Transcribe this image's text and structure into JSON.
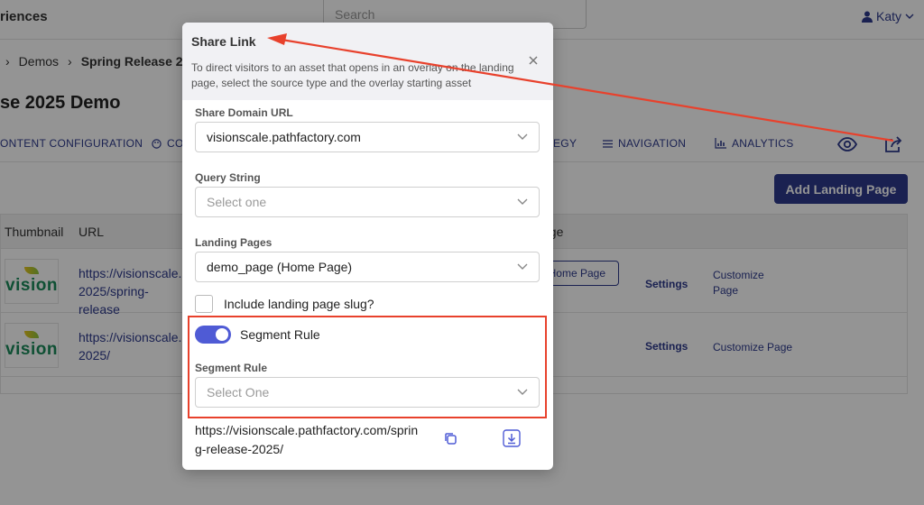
{
  "app": {
    "title": "riences",
    "search_placeholder": "Search",
    "user_name": "Katy"
  },
  "breadcrumb": {
    "items": [
      "Demos"
    ],
    "current": "Spring Release 2"
  },
  "page": {
    "title": "se 2025 Demo"
  },
  "navtabs": [
    {
      "label": "ONTENT CONFIGURATION",
      "icon": "none"
    },
    {
      "label": "CO",
      "icon": "palette-icon"
    },
    {
      "label": "EGY",
      "icon": "none"
    },
    {
      "label": "NAVIGATION",
      "icon": "list-icon"
    },
    {
      "label": "ANALYTICS",
      "icon": "bar-chart-icon"
    }
  ],
  "toolbar_icons": [
    "eye-icon",
    "share-icon"
  ],
  "add_landing_page_label": "Add Landing Page",
  "table": {
    "headers": [
      "Thumbnail",
      "URL",
      "age"
    ],
    "rows": [
      {
        "thumb_text": "vision",
        "url": "https://visionscale.p 2025/spring-release",
        "home_button": "Home Page",
        "settings": "Settings",
        "customize": "Customize Page"
      },
      {
        "thumb_text": "vision",
        "url": "https://visionscale.p 2025/",
        "home_button": "",
        "settings": "Settings",
        "customize": "Customize Page"
      }
    ]
  },
  "modal": {
    "title": "Share Link",
    "description": "To direct visitors to an asset that opens in an overlay on the landing page, select the source type and the overlay starting asset",
    "close_icon": "close-icon",
    "share_domain": {
      "label": "Share Domain URL",
      "value": "visionscale.pathfactory.com"
    },
    "query_string": {
      "label": "Query String",
      "placeholder": "Select one"
    },
    "landing_pages": {
      "label": "Landing Pages",
      "value": "demo_page (Home Page)"
    },
    "include_slug_label": "Include landing page slug?",
    "segment_toggle_label": "Segment Rule",
    "segment_rule": {
      "label": "Segment Rule",
      "placeholder": "Select One"
    },
    "share_url": "https://visionscale.pathfactory.com/spring-release-2025/",
    "copy_icon": "copy-icon",
    "download_icon": "download-icon"
  },
  "colors": {
    "accent": "#2d3a8c",
    "toggle": "#4f5bd5",
    "annotation": "#e8412c"
  }
}
